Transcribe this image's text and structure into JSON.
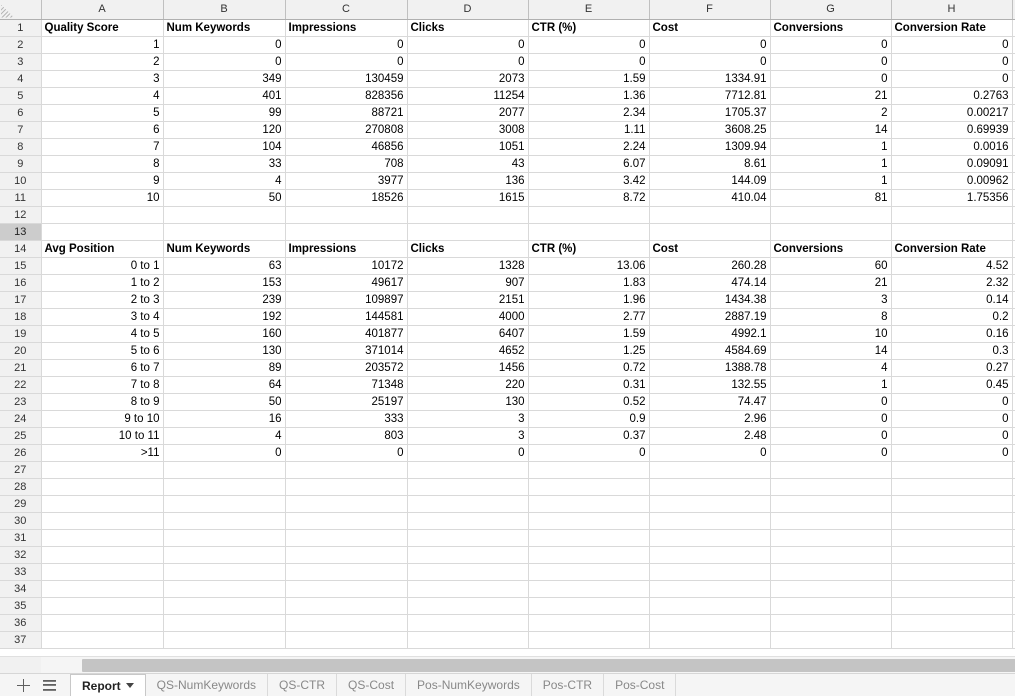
{
  "grid": {
    "column_headers": [
      "A",
      "B",
      "C",
      "D",
      "E",
      "F",
      "G",
      "H"
    ],
    "active_row": 13,
    "first_row": 1,
    "last_row": 37
  },
  "tables": {
    "quality_score": {
      "header_row": 1,
      "headers": [
        "Quality Score",
        "Num Keywords",
        "Impressions",
        "Clicks",
        "CTR (%)",
        "Cost",
        "Conversions",
        "Conversion Rate"
      ],
      "rows": [
        [
          "1",
          "0",
          "0",
          "0",
          "0",
          "0",
          "0",
          "0"
        ],
        [
          "2",
          "0",
          "0",
          "0",
          "0",
          "0",
          "0",
          "0"
        ],
        [
          "3",
          "349",
          "130459",
          "2073",
          "1.59",
          "1334.91",
          "0",
          "0"
        ],
        [
          "4",
          "401",
          "828356",
          "11254",
          "1.36",
          "7712.81",
          "21",
          "0.2763"
        ],
        [
          "5",
          "99",
          "88721",
          "2077",
          "2.34",
          "1705.37",
          "2",
          "0.00217"
        ],
        [
          "6",
          "120",
          "270808",
          "3008",
          "1.11",
          "3608.25",
          "14",
          "0.69939"
        ],
        [
          "7",
          "104",
          "46856",
          "1051",
          "2.24",
          "1309.94",
          "1",
          "0.0016"
        ],
        [
          "8",
          "33",
          "708",
          "43",
          "6.07",
          "8.61",
          "1",
          "0.09091"
        ],
        [
          "9",
          "4",
          "3977",
          "136",
          "3.42",
          "144.09",
          "1",
          "0.00962"
        ],
        [
          "10",
          "50",
          "18526",
          "1615",
          "8.72",
          "410.04",
          "81",
          "1.75356"
        ]
      ]
    },
    "avg_position": {
      "header_row": 14,
      "headers": [
        "Avg Position",
        "Num Keywords",
        "Impressions",
        "Clicks",
        "CTR (%)",
        "Cost",
        "Conversions",
        "Conversion Rate"
      ],
      "rows": [
        [
          "0 to 1",
          "63",
          "10172",
          "1328",
          "13.06",
          "260.28",
          "60",
          "4.52"
        ],
        [
          "1 to 2",
          "153",
          "49617",
          "907",
          "1.83",
          "474.14",
          "21",
          "2.32"
        ],
        [
          "2 to 3",
          "239",
          "109897",
          "2151",
          "1.96",
          "1434.38",
          "3",
          "0.14"
        ],
        [
          "3 to 4",
          "192",
          "144581",
          "4000",
          "2.77",
          "2887.19",
          "8",
          "0.2"
        ],
        [
          "4 to 5",
          "160",
          "401877",
          "6407",
          "1.59",
          "4992.1",
          "10",
          "0.16"
        ],
        [
          "5 to 6",
          "130",
          "371014",
          "4652",
          "1.25",
          "4584.69",
          "14",
          "0.3"
        ],
        [
          "6 to 7",
          "89",
          "203572",
          "1456",
          "0.72",
          "1388.78",
          "4",
          "0.27"
        ],
        [
          "7 to 8",
          "64",
          "71348",
          "220",
          "0.31",
          "132.55",
          "1",
          "0.45"
        ],
        [
          "8 to 9",
          "50",
          "25197",
          "130",
          "0.52",
          "74.47",
          "0",
          "0"
        ],
        [
          "9 to 10",
          "16",
          "333",
          "3",
          "0.9",
          "2.96",
          "0",
          "0"
        ],
        [
          "10 to 11",
          "4",
          "803",
          "3",
          "0.37",
          "2.48",
          "0",
          "0"
        ],
        [
          ">11",
          "0",
          "0",
          "0",
          "0",
          "0",
          "0",
          "0"
        ]
      ]
    }
  },
  "sheet_bar": {
    "add_sheet_label": "+",
    "all_sheets_label": "",
    "tabs": [
      {
        "label": "Report",
        "active": true
      },
      {
        "label": "QS-NumKeywords",
        "active": false
      },
      {
        "label": "QS-CTR",
        "active": false
      },
      {
        "label": "QS-Cost",
        "active": false
      },
      {
        "label": "Pos-NumKeywords",
        "active": false
      },
      {
        "label": "Pos-CTR",
        "active": false
      },
      {
        "label": "Pos-Cost",
        "active": false
      }
    ]
  }
}
